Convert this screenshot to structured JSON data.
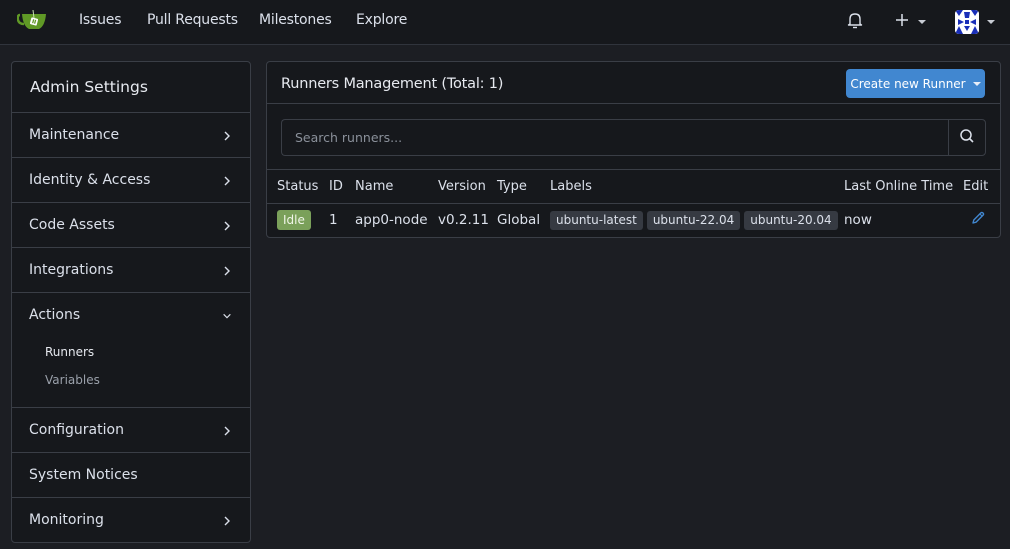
{
  "navbar": {
    "logo": "gitea-teacup-logo",
    "items": [
      {
        "label": "Issues"
      },
      {
        "label": "Pull Requests"
      },
      {
        "label": "Milestones"
      },
      {
        "label": "Explore"
      }
    ],
    "notifications_icon": "bell-icon",
    "create_icon": "plus-icon",
    "avatar": "user-avatar"
  },
  "sidebar": {
    "title": "Admin Settings",
    "items": [
      {
        "label": "Maintenance",
        "chevron": "right"
      },
      {
        "label": "Identity & Access",
        "chevron": "right"
      },
      {
        "label": "Code Assets",
        "chevron": "right"
      },
      {
        "label": "Integrations",
        "chevron": "right"
      }
    ],
    "actions": {
      "label": "Actions",
      "chevron": "down",
      "sub_items": [
        {
          "label": "Runners",
          "active": true
        },
        {
          "label": "Variables",
          "active": false
        }
      ]
    },
    "bottom_items": [
      {
        "label": "Configuration",
        "chevron": "right"
      },
      {
        "label": "System Notices"
      },
      {
        "label": "Monitoring",
        "chevron": "right"
      }
    ]
  },
  "main": {
    "title": "Runners Management (Total: 1)",
    "create_button": "Create new Runner",
    "search": {
      "placeholder": "Search runners...",
      "value": ""
    },
    "table": {
      "columns": [
        "Status",
        "ID",
        "Name",
        "Version",
        "Type",
        "Labels",
        "Last Online Time",
        "Edit"
      ],
      "rows": [
        {
          "status": "Idle",
          "id": "1",
          "name": "app0-node",
          "version": "v0.2.11",
          "type": "Global",
          "labels": [
            "ubuntu-latest",
            "ubuntu-22.04",
            "ubuntu-20.04"
          ],
          "last_online": "now",
          "edit_icon": "pencil-icon"
        }
      ]
    }
  },
  "colors": {
    "accent": "#4187d0",
    "idle_badge": "#7aa05a",
    "background": "#1c1e23",
    "panel": "#16181c",
    "logo_green": "#609926"
  }
}
